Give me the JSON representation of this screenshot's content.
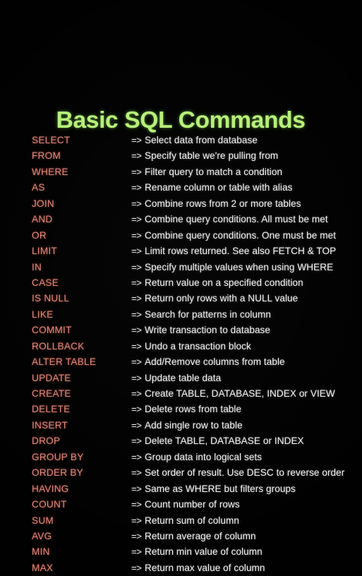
{
  "poster": {
    "title": "Basic SQL Commands",
    "arrow_glyph": "=>",
    "colors": {
      "background": "#010101",
      "title": "#b7ef79",
      "keyword": "#df8878",
      "description": "#f2f2f2",
      "arrow": "#e9e9e9"
    },
    "rows": [
      {
        "keyword": "SELECT",
        "arrow": "=>",
        "description": "Select data from database"
      },
      {
        "keyword": "FROM",
        "arrow": "=>",
        "description": "Specify table we're pulling from"
      },
      {
        "keyword": "WHERE",
        "arrow": "=>",
        "description": "Filter query to match a condition"
      },
      {
        "keyword": "AS",
        "arrow": "=>",
        "description": "Rename column or table with alias"
      },
      {
        "keyword": "JOIN",
        "arrow": "=>",
        "description": "Combine rows from 2 or more tables"
      },
      {
        "keyword": "AND",
        "arrow": "=>",
        "description": "Combine query conditions. All must be met"
      },
      {
        "keyword": "OR",
        "arrow": "=>",
        "description": "Combine query conditions. One must be met"
      },
      {
        "keyword": "LIMIT",
        "arrow": "=>",
        "description": "Limit rows returned. See also FETCH & TOP"
      },
      {
        "keyword": "IN",
        "arrow": "=>",
        "description": "Specify multiple values when using WHERE"
      },
      {
        "keyword": "CASE",
        "arrow": "=>",
        "description": "Return value on a specified condition"
      },
      {
        "keyword": "IS NULL",
        "arrow": "=>",
        "description": "Return only rows with a NULL value"
      },
      {
        "keyword": "LIKE",
        "arrow": "=>",
        "description": "Search for patterns in column"
      },
      {
        "keyword": "COMMIT",
        "arrow": "=>",
        "description": "Write transaction to database"
      },
      {
        "keyword": "ROLLBACK",
        "arrow": "=>",
        "description": "Undo a transaction block"
      },
      {
        "keyword": "ALTER TABLE",
        "arrow": "=>",
        "description": "Add/Remove columns from table"
      },
      {
        "keyword": "UPDATE",
        "arrow": "=>",
        "description": "Update table data"
      },
      {
        "keyword": "CREATE",
        "arrow": "=>",
        "description": "Create TABLE, DATABASE, INDEX or VIEW"
      },
      {
        "keyword": "DELETE",
        "arrow": "=>",
        "description": "Delete rows from table"
      },
      {
        "keyword": "INSERT",
        "arrow": "=>",
        "description": "Add single row to table"
      },
      {
        "keyword": "DROP",
        "arrow": "=>",
        "description": "Delete TABLE, DATABASE or INDEX"
      },
      {
        "keyword": "GROUP BY",
        "arrow": "=>",
        "description": "Group data into logical sets"
      },
      {
        "keyword": "ORDER BY",
        "arrow": "=>",
        "description": "Set order of result. Use DESC to reverse order"
      },
      {
        "keyword": "HAVING",
        "arrow": "=>",
        "description": "Same as WHERE but filters groups"
      },
      {
        "keyword": "COUNT",
        "arrow": "=>",
        "description": "Count number of rows"
      },
      {
        "keyword": "SUM",
        "arrow": "=>",
        "description": "Return sum of column"
      },
      {
        "keyword": "AVG",
        "arrow": "=>",
        "description": "Return average of column"
      },
      {
        "keyword": "MIN",
        "arrow": "=>",
        "description": "Return min value of column"
      },
      {
        "keyword": "MAX",
        "arrow": "=>",
        "description": "Return max value of column"
      }
    ]
  }
}
